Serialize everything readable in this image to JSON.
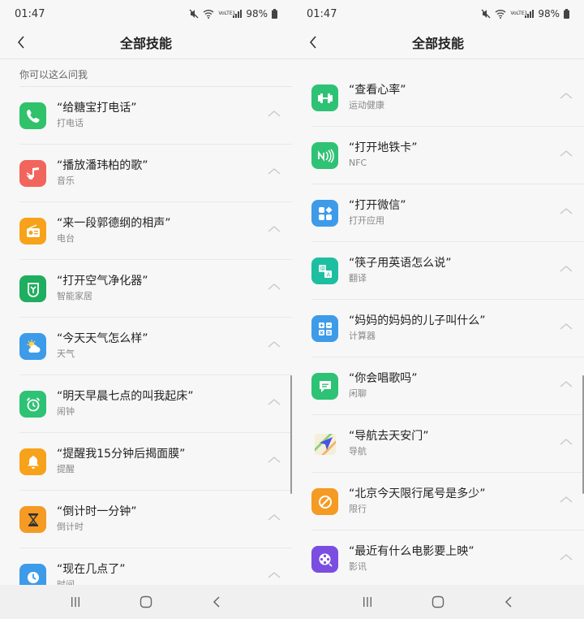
{
  "status": {
    "time": "01:47",
    "battery": "98%",
    "volte": "VoLTE1"
  },
  "header": {
    "title": "全部技能"
  },
  "left": {
    "section_label": "你可以这么问我",
    "items": [
      {
        "text": "“给糖宝打电话”",
        "category": "打电话",
        "icon": "phone-icon",
        "color": "#2fc26b"
      },
      {
        "text": "“播放潘玮柏的歌”",
        "category": "音乐",
        "icon": "music-icon",
        "color": "#f2655c"
      },
      {
        "text": "“来一段郭德纲的相声”",
        "category": "电台",
        "icon": "radio-icon",
        "color": "#f7a21b"
      },
      {
        "text": "“打开空气净化器”",
        "category": "智能家居",
        "icon": "mi-home-icon",
        "color": "#1fae5f"
      },
      {
        "text": "“今天天气怎么样”",
        "category": "天气",
        "icon": "weather-icon",
        "color": "#3d9be9"
      },
      {
        "text": "“明天早晨七点的叫我起床”",
        "category": "闹钟",
        "icon": "alarm-icon",
        "color": "#2ec275"
      },
      {
        "text": "“提醒我15分钟后揭面膜”",
        "category": "提醒",
        "icon": "bell-icon",
        "color": "#f7a21b"
      },
      {
        "text": "“倒计时一分钟”",
        "category": "倒计时",
        "icon": "hourglass-icon",
        "color": "#f59a23"
      },
      {
        "text": "“现在几点了”",
        "category": "时间",
        "icon": "clock-icon",
        "color": "#3d9be9"
      }
    ]
  },
  "right": {
    "items": [
      {
        "text": "“查看心率”",
        "category": "运动健康",
        "icon": "dumbbell-icon",
        "color": "#2ec275"
      },
      {
        "text": "“打开地铁卡”",
        "category": "NFC",
        "icon": "nfc-icon",
        "color": "#2ec275"
      },
      {
        "text": "“打开微信”",
        "category": "打开应用",
        "icon": "apps-icon",
        "color": "#3d9be9"
      },
      {
        "text": "“筷子用英语怎么说”",
        "category": "翻译",
        "icon": "translate-icon",
        "color": "#1ebfa0"
      },
      {
        "text": "“妈妈的妈妈的儿子叫什么”",
        "category": "计算器",
        "icon": "calculator-icon",
        "color": "#3d9be9"
      },
      {
        "text": "“你会唱歌吗”",
        "category": "闲聊",
        "icon": "chat-icon",
        "color": "#2ec275"
      },
      {
        "text": "“导航去天安门”",
        "category": "导航",
        "icon": "navigation-icon",
        "color": "#ffffff"
      },
      {
        "text": "“北京今天限行尾号是多少”",
        "category": "限行",
        "icon": "restriction-icon",
        "color": "#f59a23"
      },
      {
        "text": "“最近有什么电影要上映”",
        "category": "影讯",
        "icon": "film-icon",
        "color": "#7a4ee0"
      }
    ]
  }
}
